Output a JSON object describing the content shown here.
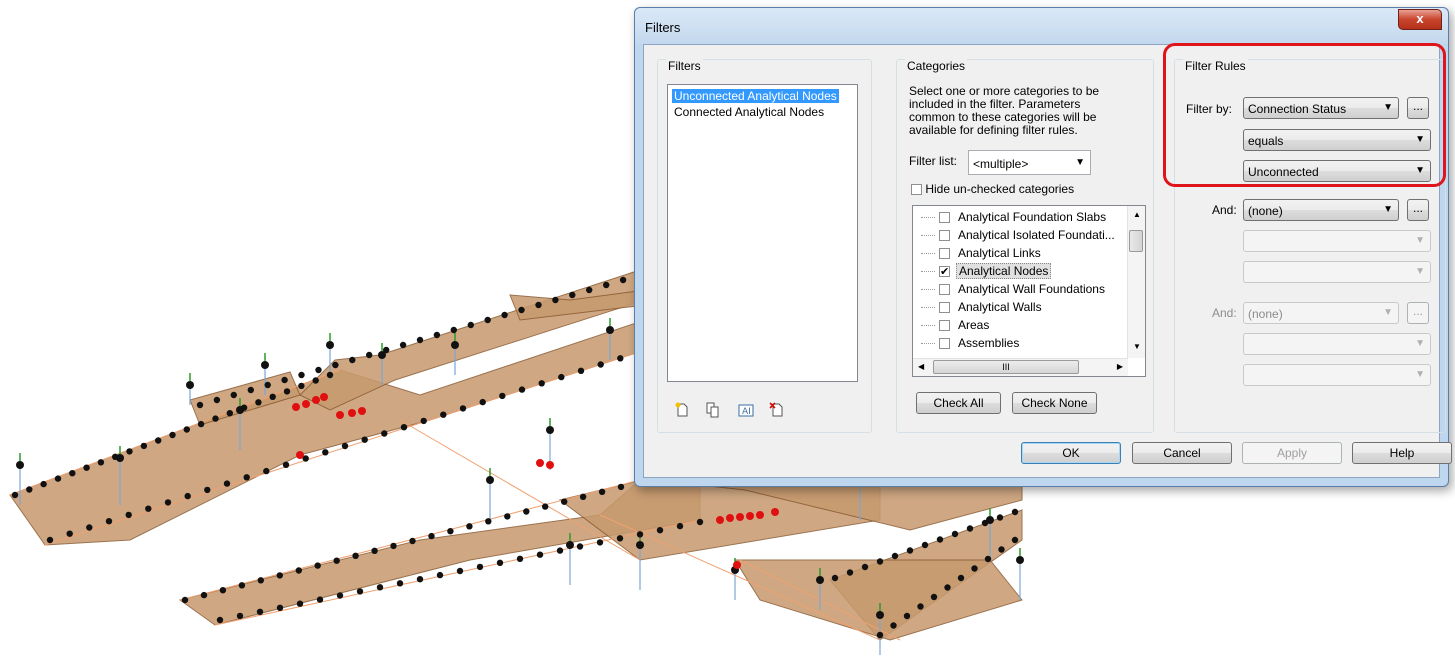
{
  "dialog": {
    "title": "Filters",
    "close_glyph": "x",
    "colors": {
      "highlight_ring": "#e0141b",
      "selection": "#3399ff",
      "slab_fill": "#c79a6e",
      "node_red": "#e01010"
    }
  },
  "filters_panel": {
    "title": "Filters",
    "items": [
      "Unconnected Analytical Nodes",
      "Connected Analytical Nodes"
    ],
    "selected_index": 0,
    "tools": [
      "new-filter-icon",
      "duplicate-filter-icon",
      "rename-filter-icon",
      "delete-filter-icon"
    ]
  },
  "categories_panel": {
    "title": "Categories",
    "description": "Select one or more categories to be included in the filter.  Parameters common to these categories will be available for defining filter rules.",
    "filter_list_label": "Filter list:",
    "filter_list_value": "<multiple>",
    "hide_unchecked_label": "Hide un-checked categories",
    "hide_unchecked_checked": false,
    "items": [
      {
        "label": "Analytical Foundation Slabs",
        "checked": false
      },
      {
        "label": "Analytical Isolated Foundati...",
        "checked": false
      },
      {
        "label": "Analytical Links",
        "checked": false
      },
      {
        "label": "Analytical Nodes",
        "checked": true
      },
      {
        "label": "Analytical Wall Foundations",
        "checked": false
      },
      {
        "label": "Analytical Walls",
        "checked": false
      },
      {
        "label": "Areas",
        "checked": false
      },
      {
        "label": "Assemblies",
        "checked": false
      }
    ],
    "hscroll_thumb": "III",
    "check_all": "Check All",
    "check_none": "Check None"
  },
  "filter_rules": {
    "title": "Filter Rules",
    "filter_by_label": "Filter by:",
    "parameter": "Connection Status",
    "operator": "equals",
    "value": "Unconnected",
    "ellipsis": "...",
    "and_label": "And:",
    "and1_value": "(none)",
    "and2_value": "(none)"
  },
  "footer": {
    "ok": "OK",
    "cancel": "Cancel",
    "apply": "Apply",
    "help": "Help"
  }
}
